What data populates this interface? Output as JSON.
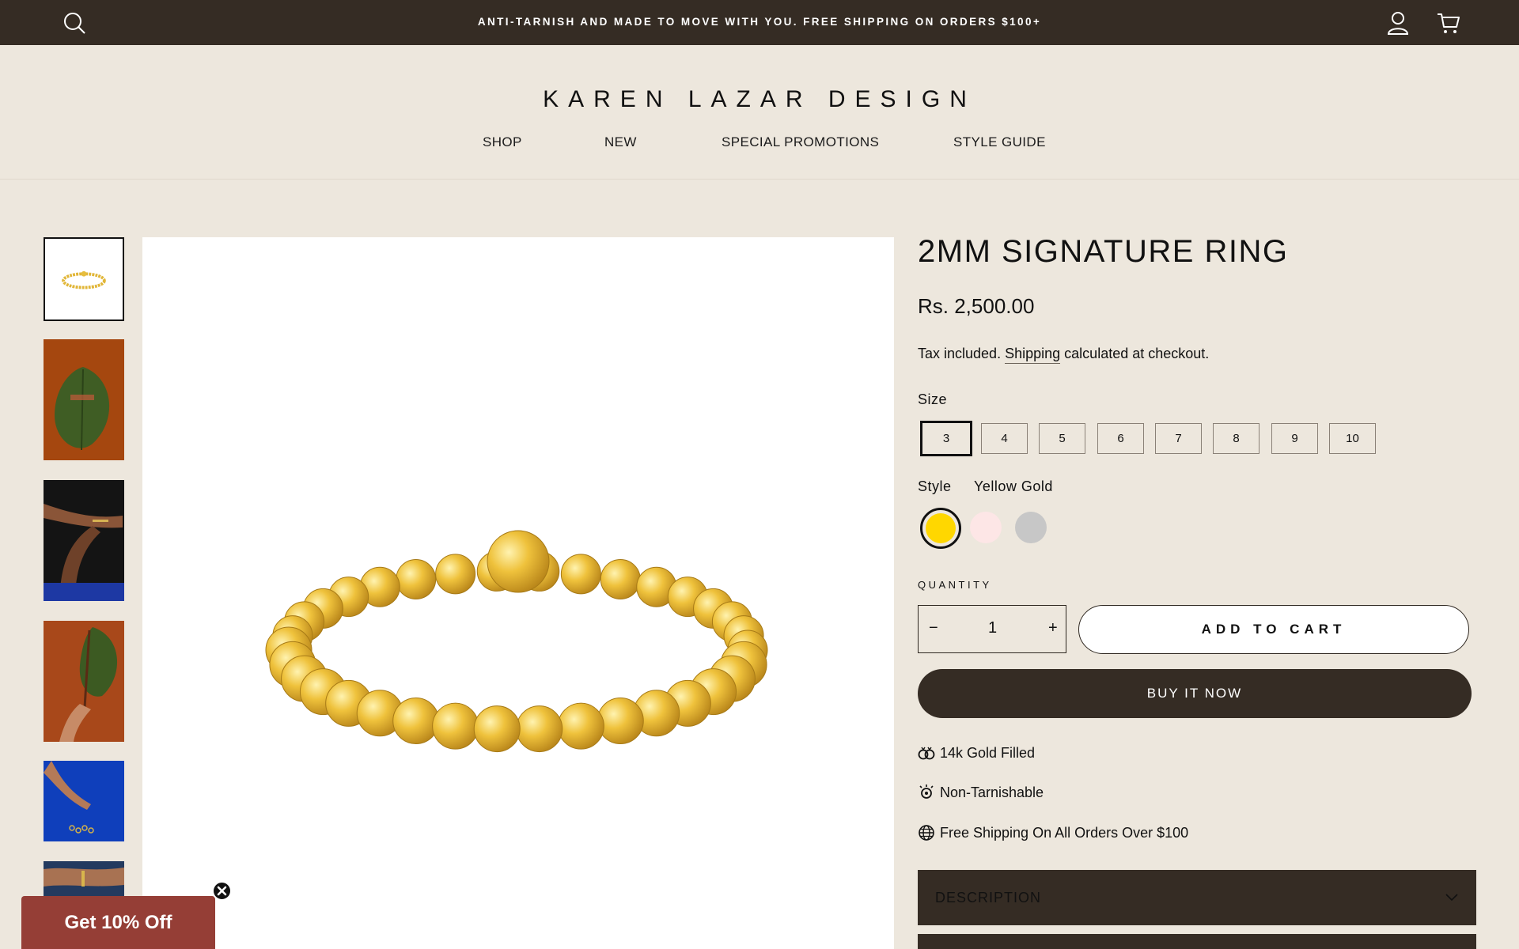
{
  "announcement": {
    "text": "ANTI-TARNISH AND MADE TO MOVE WITH YOU. FREE SHIPPING ON ORDERS $100+"
  },
  "header": {
    "logo": "KAREN LAZAR DESIGN",
    "nav": [
      "SHOP",
      "NEW",
      "SPECIAL PROMOTIONS",
      "STYLE GUIDE"
    ],
    "icons": [
      "search-icon",
      "account-icon",
      "cart-icon"
    ]
  },
  "product": {
    "title": "2MM SIGNATURE RING",
    "price": "Rs. 2,500.00",
    "tax_prefix": "Tax included.",
    "tax_link": "Shipping",
    "tax_suffix": "calculated at checkout.",
    "size_label": "Size",
    "sizes": [
      "3",
      "4",
      "5",
      "6",
      "7",
      "8",
      "9",
      "10"
    ],
    "selected_size": "3",
    "style_label": "Style",
    "style_value": "Yellow Gold",
    "style_colors": [
      "#ffd700",
      "#fde6e6",
      "#c7c7c7"
    ],
    "quantity_label": "QUANTITY",
    "quantity": "1",
    "quantity_minus": "−",
    "quantity_plus": "+",
    "add_to_cart": "ADD TO CART",
    "buy_now": "BUY IT NOW",
    "features": [
      "14k Gold Filled",
      "Non-Tarnishable",
      "Free Shipping On All Orders Over $100"
    ],
    "accordion": [
      "DESCRIPTION"
    ]
  },
  "promo": {
    "label": "Get 10% Off"
  },
  "colors": {
    "dark": "#352c24",
    "background": "#ede7dd",
    "promo": "#953e36",
    "gold": "#e6b62a"
  }
}
